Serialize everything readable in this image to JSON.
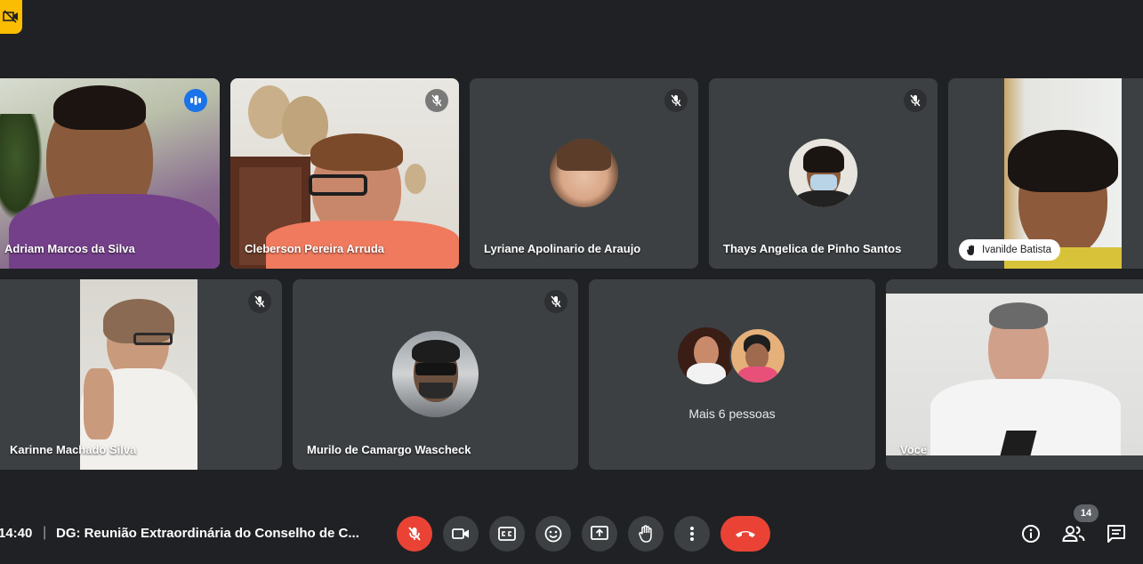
{
  "meeting": {
    "time": "14:40",
    "separator": "|",
    "title": "DG: Reunião Extraordinária do Conselho de C..."
  },
  "participants": [
    {
      "name": "Adriam Marcos da Silva",
      "state": "speaking"
    },
    {
      "name": "Cleberson Pereira Arruda",
      "state": "muted"
    },
    {
      "name": "Lyriane Apolinario de Araujo",
      "state": "muted"
    },
    {
      "name": "Thays Angelica de Pinho Santos",
      "state": "muted"
    },
    {
      "name": "Ivanilde Batista",
      "state": "hand-raised"
    },
    {
      "name": "Karinne Machado Silva",
      "state": "muted"
    },
    {
      "name": "Murilo de Camargo Wascheck",
      "state": "muted"
    },
    {
      "name": "Você",
      "state": "self"
    }
  ],
  "overflow_tile": {
    "label": "Mais 6 pessoas"
  },
  "people_count": "14",
  "colors": {
    "background": "#202124",
    "tile": "#3c4043",
    "speaking_outline": "#8ab4f8",
    "danger": "#ea4335",
    "warning_badge": "#fbbc04"
  },
  "controls": [
    {
      "name": "mic-off",
      "icon": "mic-off-icon"
    },
    {
      "name": "camera",
      "icon": "videocam-icon"
    },
    {
      "name": "captions",
      "icon": "closed-caption-icon"
    },
    {
      "name": "reactions",
      "icon": "emoji-icon"
    },
    {
      "name": "present",
      "icon": "present-screen-icon"
    },
    {
      "name": "raise-hand",
      "icon": "hand-icon"
    },
    {
      "name": "more-options",
      "icon": "more-vert-icon"
    },
    {
      "name": "leave-call",
      "icon": "call-end-icon"
    }
  ],
  "right_controls": [
    {
      "name": "meeting-details",
      "icon": "info-icon"
    },
    {
      "name": "people",
      "icon": "people-icon"
    },
    {
      "name": "chat",
      "icon": "chat-icon"
    }
  ]
}
